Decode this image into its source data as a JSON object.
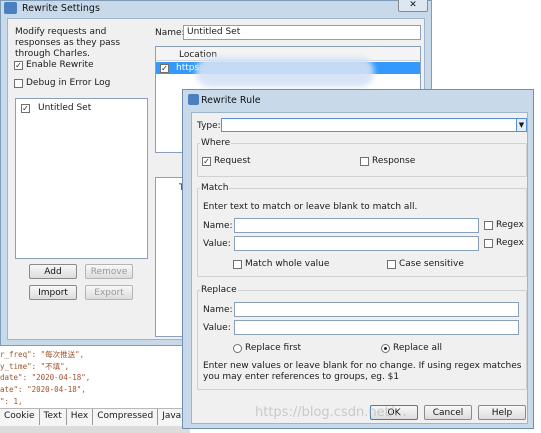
{
  "background": {
    "code_lines": [
      "r_freq\": \"每次推送\",",
      "y_time\": \"不填\",",
      "date\": \"2020-04-18\",",
      "ate\": \"2020-04-18\",",
      "\": 1,"
    ],
    "bottom_tabs": [
      "Cookie",
      "Text",
      "Hex",
      "Compressed",
      "JavaScript"
    ]
  },
  "settings_window": {
    "title": "Rewrite Settings",
    "close_glyph": "✕",
    "description": "Modify requests and responses as they pass through Charles.",
    "enable_rewrite": {
      "label": "Enable Rewrite",
      "checked": true
    },
    "debug_error_log": {
      "label": "Debug in Error Log",
      "checked": false
    },
    "sets": [
      {
        "name": "Untitled Set",
        "checked": true
      }
    ],
    "buttons": {
      "add": "Add",
      "remove": "Remove",
      "import": "Import",
      "export": "Export"
    },
    "name_label": "Name:",
    "name_value": "Untitled Set",
    "locations_header": "Location",
    "location_item": {
      "text": "https:",
      "checked": true
    },
    "rules_header_fragment": "T"
  },
  "rule_dialog": {
    "title": "Rewrite Rule",
    "type_label": "Type:",
    "type_value": "",
    "where": {
      "legend": "Where",
      "request": {
        "label": "Request",
        "checked": true
      },
      "response": {
        "label": "Response",
        "checked": false
      }
    },
    "match": {
      "legend": "Match",
      "hint": "Enter text to match or leave blank to match all.",
      "name_label": "Name:",
      "value_label": "Value:",
      "regex_label": "Regex",
      "whole_value": "Match whole value",
      "case_sensitive": "Case sensitive"
    },
    "replace": {
      "legend": "Replace",
      "name_label": "Name:",
      "value_label": "Value:",
      "replace_first": "Replace first",
      "replace_all": "Replace all",
      "selected": "replace_all",
      "hint": "Enter new values or leave blank for no change. If using regex matches you may enter references to groups, eg. $1"
    },
    "buttons": {
      "ok": "OK",
      "cancel": "Cancel",
      "help": "Help"
    }
  },
  "watermark": "https://blog.csdn.net/..."
}
